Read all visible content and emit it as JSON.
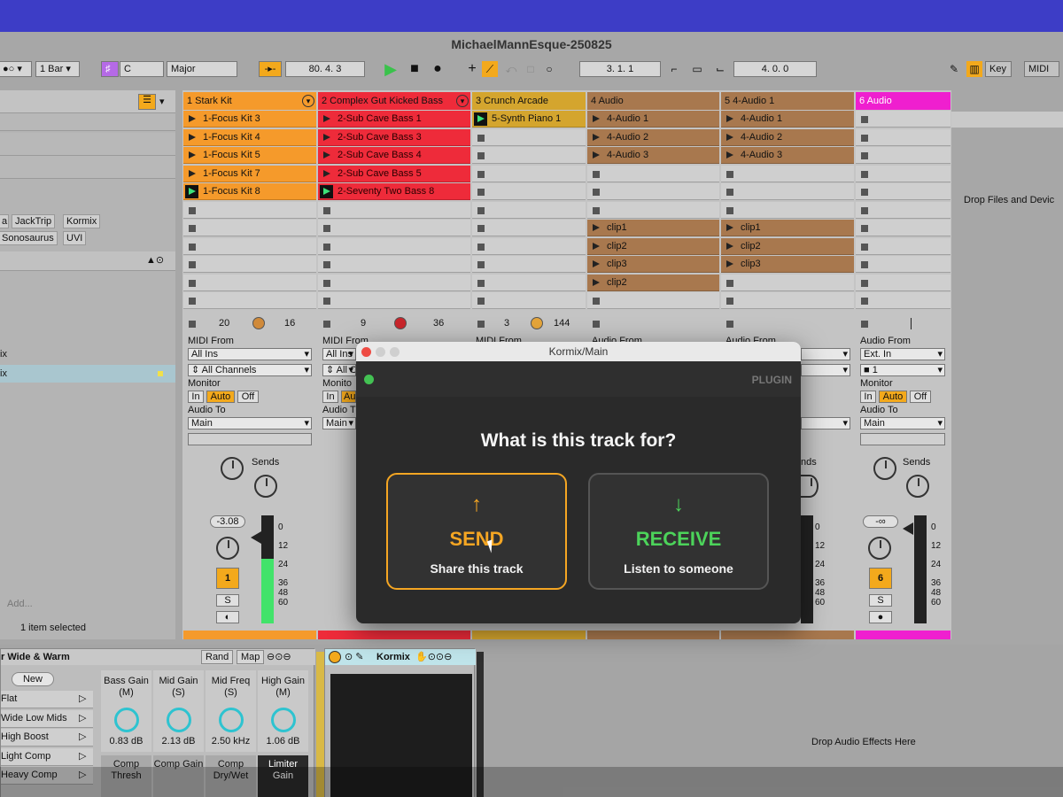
{
  "window": {
    "title": "MichaelMannEsque-250825"
  },
  "transport": {
    "quantize": "1 Bar",
    "key_root": "C",
    "scale": "Major",
    "arrangement_position": "80.   4.   3",
    "loop_start": "3.   1.   1",
    "loop_length": "4.   0.   0",
    "key_label": "Key",
    "midi_label": "MIDI"
  },
  "browser": {
    "tags": [
      "JackTrip",
      "Kormix",
      "Sonosaurus",
      "UVI"
    ],
    "item_mix_1": "ix",
    "item_mix_2": "ix",
    "add_placeholder": "Add...",
    "status": "1 item selected"
  },
  "tracks": [
    {
      "name": "1 Stark Kit",
      "color": "#f59a2b",
      "clips": [
        "1-Focus Kit 3",
        "1-Focus Kit 4",
        "1-Focus Kit 5",
        "1-Focus Kit 7",
        "1-Focus Kit 8"
      ],
      "playing_index": 4,
      "stats": [
        "20",
        "16"
      ],
      "input_label": "MIDI From",
      "input": "All Ins",
      "channel": "All Channels",
      "monitor_label": "Monitor",
      "monitor": [
        "In",
        "Auto",
        "Off"
      ],
      "output_label": "Audio To",
      "output": "Main",
      "sends_label": "Sends",
      "volume": "-3.08",
      "track_number": "1",
      "solo": "S"
    },
    {
      "name": "2 Complex Gut Kicked Bass",
      "color": "#ee2b3a",
      "clips": [
        "2-Sub Cave Bass 1",
        "2-Sub Cave Bass 3",
        "2-Sub Cave Bass 4",
        "2-Sub Cave Bass 5",
        "2-Seventy Two Bass 8"
      ],
      "playing_index": 4,
      "stats": [
        "9",
        "36"
      ],
      "input_label": "MIDI From",
      "input": "All Ins",
      "channel": "All C",
      "monitor_label": "Monito",
      "output_label": "Audio T",
      "output": "Main"
    },
    {
      "name": "3 Crunch Arcade",
      "color": "#d4a52e",
      "clips": [
        "5-Synth Piano 1"
      ],
      "playing_index": 0,
      "stats": [
        "3",
        "144"
      ],
      "input_label": "MIDI From"
    },
    {
      "name": "4 Audio",
      "color": "#a8784e",
      "clips": [
        "4-Audio 1",
        "4-Audio 2",
        "4-Audio 3"
      ],
      "clips_b": [
        "clip1",
        "clip2",
        "clip3",
        "clip2"
      ],
      "input_label": "Audio From"
    },
    {
      "name": "5 4-Audio 1",
      "color": "#a8784e",
      "clips": [
        "4-Audio 1",
        "4-Audio 2",
        "4-Audio 3"
      ],
      "clips_b": [
        "clip1",
        "clip2",
        "clip3"
      ],
      "input_label": "Audio From",
      "sends_label": "nds"
    },
    {
      "name": "6 Audio",
      "color": "#ef1fcf",
      "input_label": "Audio From",
      "input": "Ext. In",
      "channel": "1",
      "monitor_label": "Monitor",
      "monitor": [
        "In",
        "Auto",
        "Off"
      ],
      "output_label": "Audio To",
      "output": "Main",
      "sends_label": "Sends",
      "volume": "-∞",
      "track_number": "6",
      "solo": "S"
    }
  ],
  "meter_scale": [
    "0",
    "12",
    "24",
    "36",
    "48",
    "60"
  ],
  "drop_files_text": "Drop Files and Devic",
  "devices": {
    "rack_name": "r Wide & Warm",
    "rand_label": "Rand",
    "map_label": "Map",
    "new_label": "New",
    "presets": [
      "Flat",
      "Wide Low Mids",
      "High Boost",
      "Light Comp",
      "Heavy Comp"
    ],
    "macros": [
      {
        "name": "Bass Gain (M)",
        "value": "0.83 dB"
      },
      {
        "name": "Mid Gain (S)",
        "value": "2.13 dB"
      },
      {
        "name": "Mid Freq (S)",
        "value": "2.50 kHz"
      },
      {
        "name": "High Gain (M)",
        "value": "1.06 dB"
      }
    ],
    "macros_row2": [
      "Comp Thresh",
      "Comp Gain",
      "Comp Dry/Wet",
      "Limiter Gain"
    ],
    "plugin_name": "Kormix",
    "drop_effects_text": "Drop Audio Effects Here"
  },
  "kormix_dialog": {
    "title": "Kormix/Main",
    "plugin_label": "PLUGIN",
    "question": "What is this track for?",
    "send": {
      "arrow": "↑",
      "label": "SEND",
      "subtitle": "Share this track",
      "color": "#f5a623"
    },
    "receive": {
      "arrow": "↓",
      "label": "RECEIVE",
      "subtitle": "Listen to someone",
      "color": "#4cd35a"
    }
  }
}
